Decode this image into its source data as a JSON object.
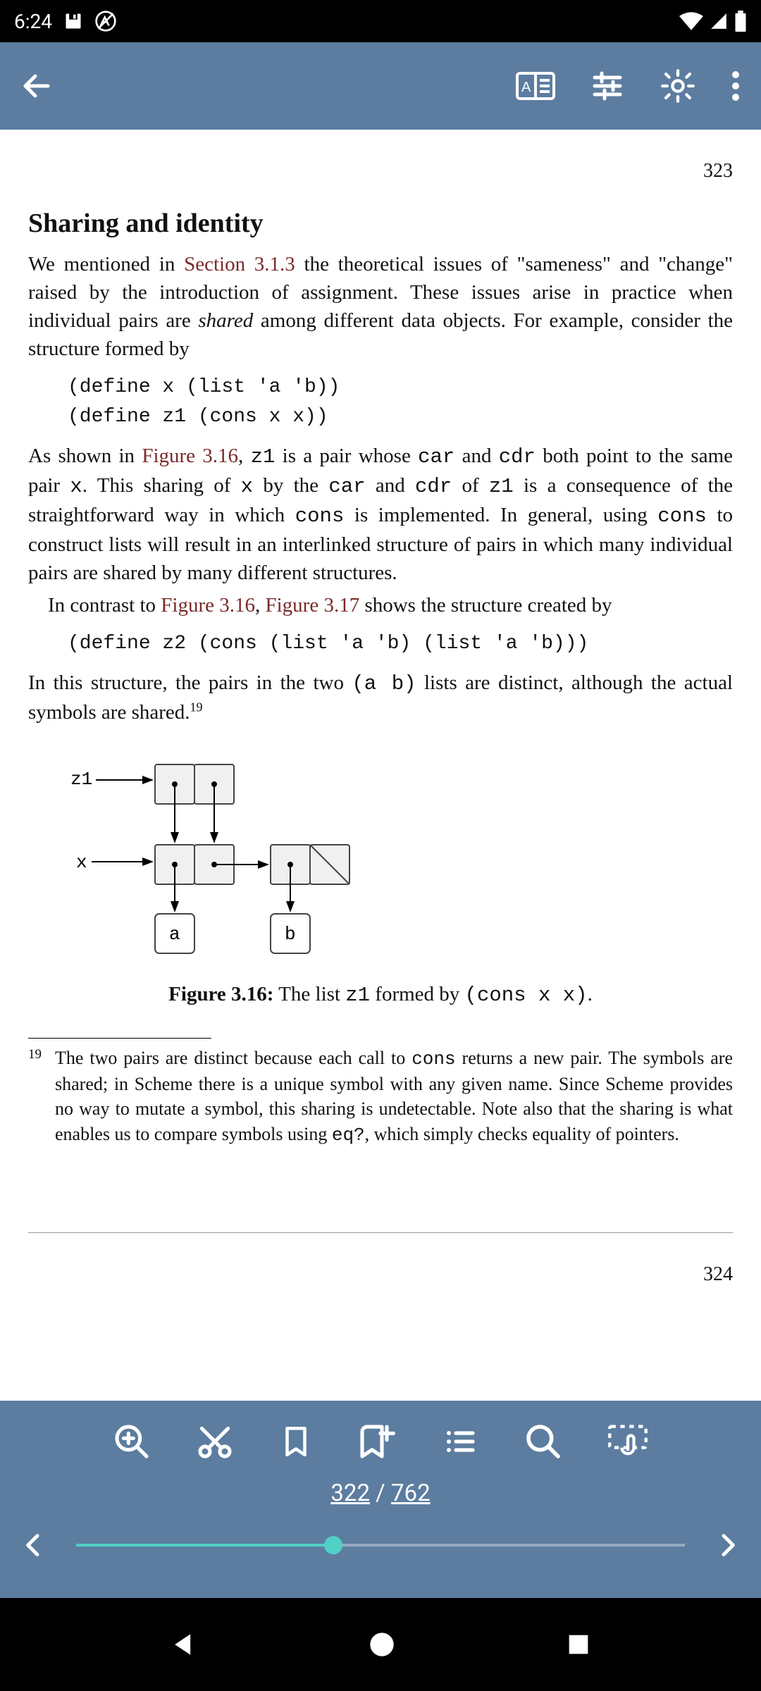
{
  "status": {
    "time": "6:24"
  },
  "page": {
    "num_top": "323",
    "title": "Sharing and identity",
    "p1a": "We mentioned in ",
    "p1_link1": "Section 3.1.3",
    "p1b": " the theoretical issues of \"sameness\" and \"change\" raised by the introduction of assignment.  These issues arise in practice when individual pairs are ",
    "p1_ital": "shared",
    "p1c": " among different data objects. For example, consider the structure formed by",
    "code1_l1": "(define x (list 'a 'b))",
    "code1_l2": "(define z1 (cons x x))",
    "p2a": "As shown in ",
    "p2_link1": "Figure 3.16",
    "p2b": ", ",
    "p2_z1": "z1",
    "p2c": " is a pair whose ",
    "p2_car": "car",
    "p2d": " and ",
    "p2_cdr": "cdr",
    "p2e": " both point to the same pair ",
    "p2_x": "x",
    "p2f": ".  This sharing of ",
    "p2_x2": "x",
    "p2g": " by the ",
    "p2_car2": "car",
    "p2h": " and ",
    "p2_cdr2": "cdr",
    "p2i": " of ",
    "p2_z1b": "z1",
    "p2j": " is a consequence of the straightforward way in which ",
    "p2_cons": "cons",
    "p2k": " is implemented.  In general, using ",
    "p2_cons2": "cons",
    "p2l": " to construct lists will result in an interlinked structure of pairs in which many individual pairs are shared by many different structures.",
    "p3a": "In contrast to ",
    "p3_link1": "Figure 3.16",
    "p3b": ", ",
    "p3_link2": "Figure 3.17",
    "p3c": " shows the structure created by",
    "code2_l1": "(define z2 (cons (list 'a 'b) (list 'a 'b)))",
    "p4a": "In this structure, the pairs in the two ",
    "p4_ab": "(a b)",
    "p4b": " lists are distinct, although the actual symbols are shared.",
    "p4_sup": "19",
    "fig_z1": "z1",
    "fig_x": "x",
    "fig_a": "a",
    "fig_b": "b",
    "caption_bold": "Figure 3.16:",
    "caption_a": " The list ",
    "caption_z1": "z1",
    "caption_b": " formed by ",
    "caption_code": "(cons x x)",
    "caption_c": ".",
    "footnote_num": "19",
    "footnote_a": "The two pairs are distinct because each call to ",
    "footnote_cons": "cons",
    "footnote_b": " returns a new pair. The symbols are shared; in Scheme there is a unique symbol with any given name. Since Scheme provides no way to mutate a symbol, this sharing is undetectable.  Note also that the sharing is what enables us to compare symbols using ",
    "footnote_eq": "eq?",
    "footnote_c": ", which simply checks equality of pointers.",
    "num_bottom": "324"
  },
  "pager": {
    "current": "322",
    "sep": " / ",
    "total": "762"
  }
}
